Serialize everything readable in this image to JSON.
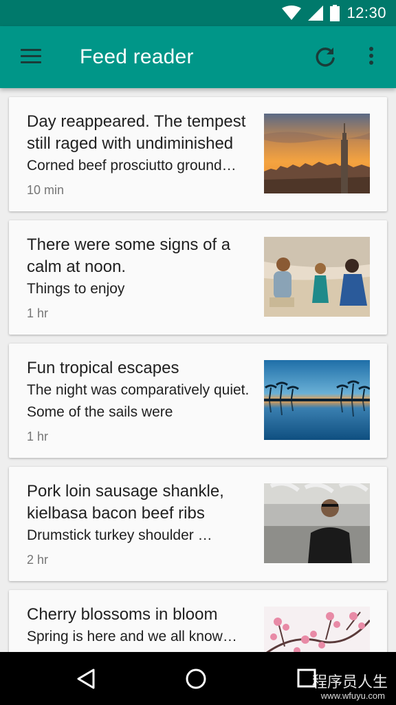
{
  "status_bar": {
    "time": "12:30",
    "icons": [
      "wifi-icon",
      "signal-icon",
      "battery-icon"
    ]
  },
  "app_bar": {
    "title": "Feed reader",
    "icons": [
      "menu-icon",
      "refresh-icon",
      "more-vert-icon"
    ],
    "color": "#009688"
  },
  "feed": {
    "items": [
      {
        "title": "Day reappeared. The tempest still raged with undiminished",
        "summary": "Corned beef prosciutto ground…",
        "time": "10 min",
        "image": "city-skyline-sunset"
      },
      {
        "title": "There were some signs of a calm at noon.",
        "summary": "Things to enjoy",
        "time": "1 hr",
        "image": "family-on-beach"
      },
      {
        "title": "Fun tropical escapes",
        "summary": "The night was comparatively quiet. Some of the sails were",
        "time": "1 hr",
        "image": "palm-trees-sunset"
      },
      {
        "title": "Pork loin sausage shankle, kielbasa bacon beef ribs",
        "summary": "Drumstick turkey shoulder …",
        "time": "2 hr",
        "image": "man-in-kitchen"
      },
      {
        "title": "Cherry blossoms in bloom",
        "summary": "Spring is here and we all know…",
        "time": "",
        "image": "cherry-blossoms"
      }
    ]
  },
  "nav_bar": {
    "icons": [
      "back-icon",
      "home-icon",
      "recents-icon"
    ]
  },
  "watermark": {
    "text": "程序员人生",
    "url": "www.wfuyu.com"
  }
}
